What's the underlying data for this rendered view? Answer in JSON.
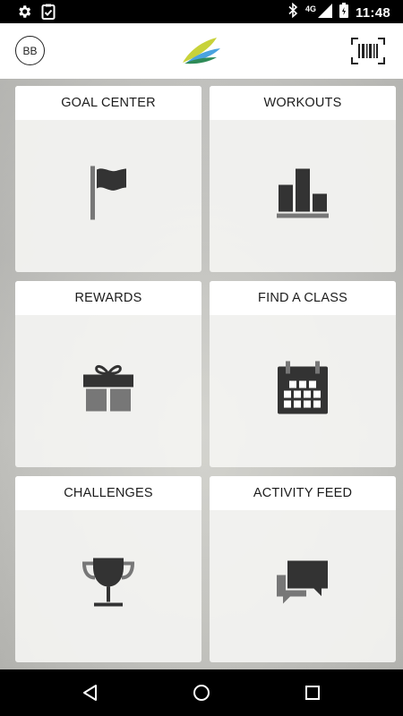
{
  "status_bar": {
    "time": "11:48",
    "network": "4G",
    "icons": [
      "gear-icon",
      "clipboard-check-icon",
      "bluetooth-icon",
      "signal-icon",
      "battery-icon"
    ]
  },
  "header": {
    "avatar_initials": "BB",
    "logo_icon": "leaf-logo-icon",
    "barcode_icon": "barcode-scan-icon",
    "logo_colors": [
      "#c8d23a",
      "#8bc34a",
      "#4aa3df",
      "#2e8b57"
    ]
  },
  "tiles": [
    {
      "label": "GOAL CENTER",
      "icon": "flag-icon"
    },
    {
      "label": "WORKOUTS",
      "icon": "bar-chart-icon"
    },
    {
      "label": "REWARDS",
      "icon": "gift-icon"
    },
    {
      "label": "FIND A CLASS",
      "icon": "calendar-icon"
    },
    {
      "label": "CHALLENGES",
      "icon": "trophy-icon"
    },
    {
      "label": "ACTIVITY FEED",
      "icon": "chat-bubbles-icon"
    }
  ],
  "nav": {
    "back_icon": "back-triangle-icon",
    "home_icon": "home-circle-icon",
    "recents_icon": "recents-square-icon"
  },
  "colors": {
    "icon_dark": "#333333",
    "icon_gray": "#777777"
  }
}
